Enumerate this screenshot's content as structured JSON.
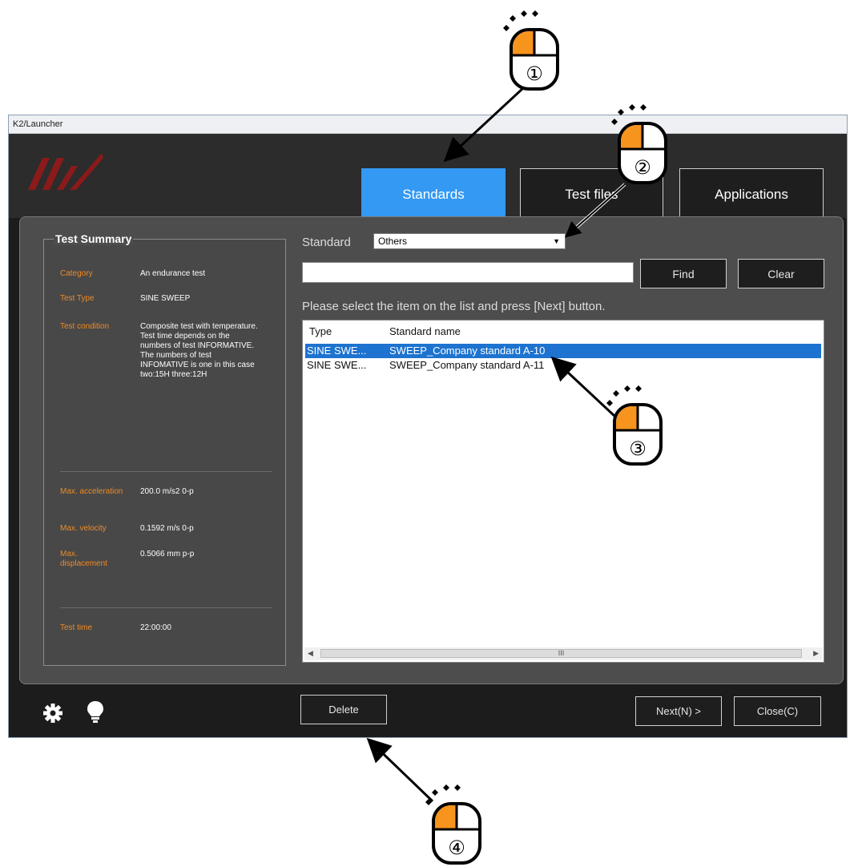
{
  "window": {
    "title": "K2/Launcher"
  },
  "nav": {
    "standards": "Standards",
    "test_files": "Test files",
    "applications": "Applications"
  },
  "summary": {
    "title": "Test Summary",
    "rows": [
      {
        "label": "Category",
        "value": "An endurance test"
      },
      {
        "label": "Test Type",
        "value": "SINE SWEEP"
      },
      {
        "label": "Test condition",
        "value": "Composite test with temperature.\nTest time depends on the numbers of test INFORMATIVE.\nThe numbers of test INFOMATIVE is one in this case two:15H three:12H"
      },
      {
        "label": "Max. acceleration",
        "value": "200.0 m/s2 0-p"
      },
      {
        "label": "Max. velocity",
        "value": "0.1592 m/s 0-p"
      },
      {
        "label": "Max. displacement",
        "value": "0.5066 mm p-p"
      },
      {
        "label": "Test time",
        "value": "22:00:00"
      }
    ]
  },
  "standard": {
    "label": "Standard",
    "selected": "Others"
  },
  "search": {
    "value": "",
    "find": "Find",
    "clear": "Clear"
  },
  "instruction": "Please select the item on the list and press [Next] button.",
  "list": {
    "columns": [
      "Type",
      "Standard name"
    ],
    "rows": [
      {
        "type": "SINE SWE...",
        "name": "SWEEP_Company standard  A-10",
        "selected": true
      },
      {
        "type": "SINE SWE...",
        "name": "SWEEP_Company standard  A-11",
        "selected": false
      }
    ],
    "scroll_thumb": "III"
  },
  "footer": {
    "delete": "Delete",
    "next": "Next(N) >",
    "close": "Close(C)"
  },
  "annotations": {
    "steps": [
      "①",
      "②",
      "③",
      "④"
    ]
  },
  "colors": {
    "accent": "#3399f3",
    "selection": "#1d73cf",
    "label_orange": "#f08a24",
    "mouse_button": "#f7941d"
  }
}
